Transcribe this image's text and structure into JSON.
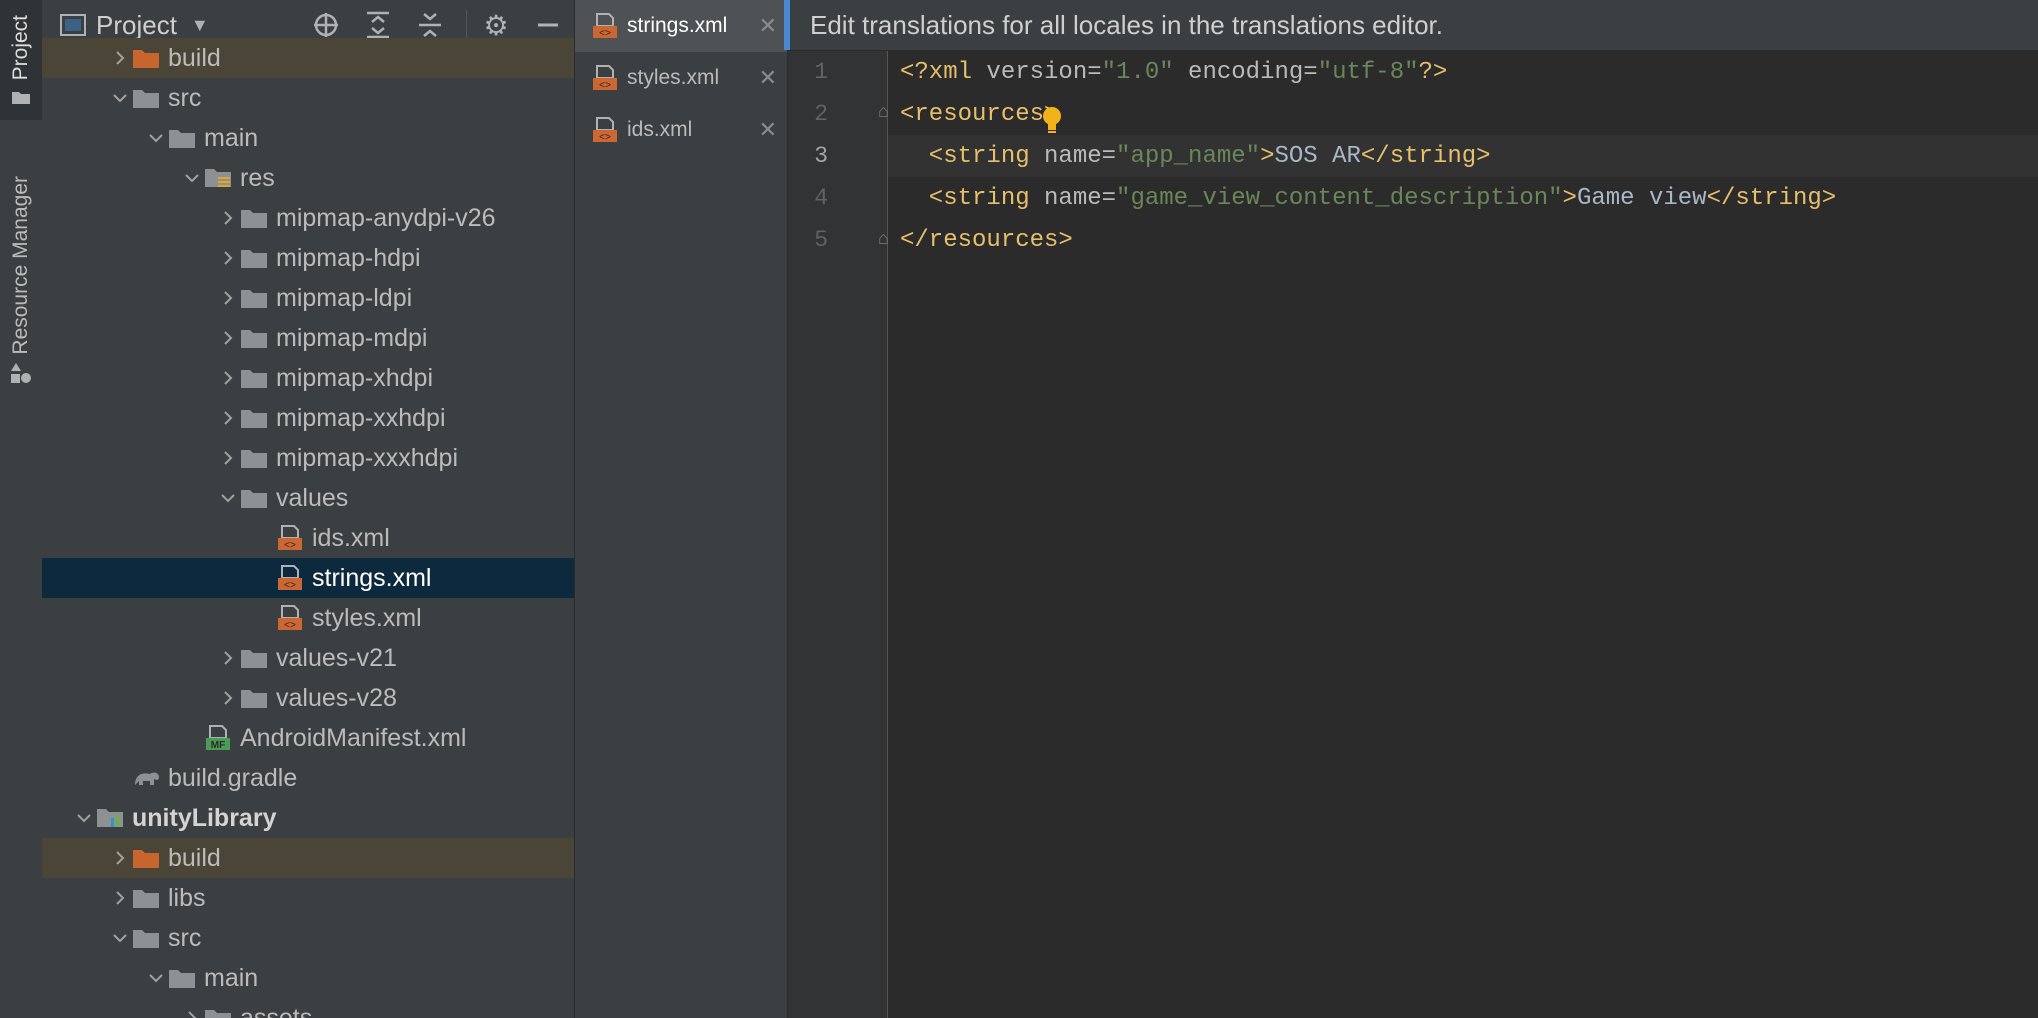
{
  "sidebar_strip": {
    "project_label": "Project",
    "resource_manager_label": "Resource Manager"
  },
  "project_panel": {
    "title": "Project",
    "tree": [
      {
        "label": "build",
        "indent": 3,
        "chevron": "right",
        "icon": "folder-orange",
        "state": "excluded"
      },
      {
        "label": "src",
        "indent": 3,
        "chevron": "down",
        "icon": "folder"
      },
      {
        "label": "main",
        "indent": 4,
        "chevron": "down",
        "icon": "folder"
      },
      {
        "label": "res",
        "indent": 5,
        "chevron": "down",
        "icon": "res-folder"
      },
      {
        "label": "mipmap-anydpi-v26",
        "indent": 6,
        "chevron": "right",
        "icon": "folder"
      },
      {
        "label": "mipmap-hdpi",
        "indent": 6,
        "chevron": "right",
        "icon": "folder"
      },
      {
        "label": "mipmap-ldpi",
        "indent": 6,
        "chevron": "right",
        "icon": "folder"
      },
      {
        "label": "mipmap-mdpi",
        "indent": 6,
        "chevron": "right",
        "icon": "folder"
      },
      {
        "label": "mipmap-xhdpi",
        "indent": 6,
        "chevron": "right",
        "icon": "folder"
      },
      {
        "label": "mipmap-xxhdpi",
        "indent": 6,
        "chevron": "right",
        "icon": "folder"
      },
      {
        "label": "mipmap-xxxhdpi",
        "indent": 6,
        "chevron": "right",
        "icon": "folder"
      },
      {
        "label": "values",
        "indent": 6,
        "chevron": "down",
        "icon": "folder"
      },
      {
        "label": "ids.xml",
        "indent": 7,
        "chevron": "none",
        "icon": "xml-file"
      },
      {
        "label": "strings.xml",
        "indent": 7,
        "chevron": "none",
        "icon": "xml-file",
        "state": "selected"
      },
      {
        "label": "styles.xml",
        "indent": 7,
        "chevron": "none",
        "icon": "xml-file"
      },
      {
        "label": "values-v21",
        "indent": 6,
        "chevron": "right",
        "icon": "folder"
      },
      {
        "label": "values-v28",
        "indent": 6,
        "chevron": "right",
        "icon": "folder"
      },
      {
        "label": "AndroidManifest.xml",
        "indent": 5,
        "chevron": "none",
        "icon": "manifest-file"
      },
      {
        "label": "build.gradle",
        "indent": 3,
        "chevron": "none",
        "icon": "gradle-file"
      },
      {
        "label": "unityLibrary",
        "indent": 2,
        "chevron": "down",
        "icon": "module-folder",
        "state": "bold"
      },
      {
        "label": "build",
        "indent": 3,
        "chevron": "right",
        "icon": "folder-orange",
        "state": "excluded"
      },
      {
        "label": "libs",
        "indent": 3,
        "chevron": "right",
        "icon": "folder"
      },
      {
        "label": "src",
        "indent": 3,
        "chevron": "down",
        "icon": "folder"
      },
      {
        "label": "main",
        "indent": 4,
        "chevron": "down",
        "icon": "folder"
      },
      {
        "label": "assets",
        "indent": 5,
        "chevron": "right",
        "icon": "folder"
      }
    ]
  },
  "editor_tabs": [
    {
      "label": "strings.xml",
      "active": true
    },
    {
      "label": "styles.xml",
      "active": false
    },
    {
      "label": "ids.xml",
      "active": false
    }
  ],
  "banner": {
    "text": "Edit translations for all locales in the translations editor."
  },
  "editor": {
    "current_line": 3,
    "lines": [
      {
        "num": "1",
        "tokens": [
          {
            "t": "<?xml ",
            "c": "tag"
          },
          {
            "t": "version=",
            "c": "attr"
          },
          {
            "t": "\"1.0\"",
            "c": "val"
          },
          {
            "t": " encoding=",
            "c": "attr"
          },
          {
            "t": "\"utf-8\"",
            "c": "val"
          },
          {
            "t": "?>",
            "c": "tag"
          }
        ]
      },
      {
        "num": "2",
        "tokens": [
          {
            "t": "<resources>",
            "c": "tag"
          }
        ]
      },
      {
        "num": "3",
        "tokens": [
          {
            "t": "  <string ",
            "c": "tag"
          },
          {
            "t": "name=",
            "c": "attr"
          },
          {
            "t": "\"app_name\"",
            "c": "val"
          },
          {
            "t": ">",
            "c": "tag"
          },
          {
            "t": "SOS AR",
            "c": "txt"
          },
          {
            "t": "</string>",
            "c": "tag"
          }
        ]
      },
      {
        "num": "4",
        "tokens": [
          {
            "t": "  <string ",
            "c": "tag"
          },
          {
            "t": "name=",
            "c": "attr"
          },
          {
            "t": "\"game_view_content_description\"",
            "c": "val"
          },
          {
            "t": ">",
            "c": "tag"
          },
          {
            "t": "Game view",
            "c": "txt"
          },
          {
            "t": "</string>",
            "c": "tag"
          }
        ]
      },
      {
        "num": "5",
        "tokens": [
          {
            "t": "</resources>",
            "c": "tag"
          }
        ]
      }
    ]
  },
  "colors": {
    "selection": "#0d293e",
    "excluded_folder": "#4a4537",
    "accent": "#4d88d3",
    "xml_file_icon": "#cc6633",
    "bulb": "#f2b31a"
  }
}
